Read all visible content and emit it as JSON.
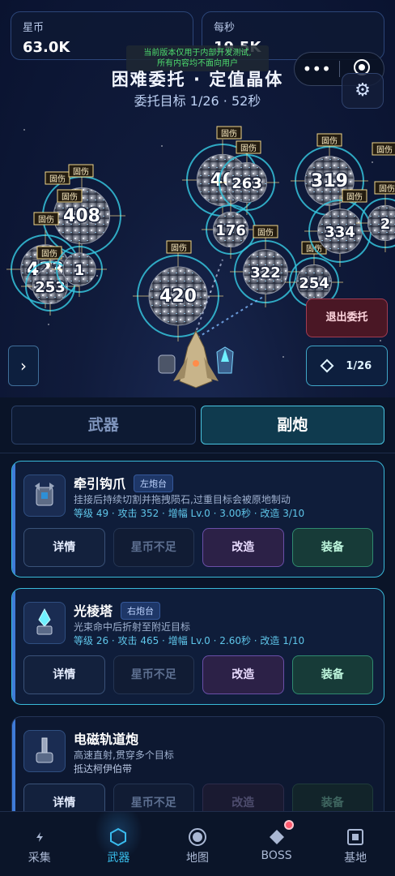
{
  "stats": {
    "stars_label": "星币",
    "stars_value": "63.0K",
    "per_sec_label": "每秒",
    "per_sec_value": "19.5K"
  },
  "dev_notice": {
    "line1": "当前版本仅用于内部开发测试,",
    "line2": "所有内容均不面向用户"
  },
  "mission": {
    "title": "困难委托 · 定值晶体",
    "subtitle": "委托目标 1/26 · 52秒",
    "exit_label": "退出委托",
    "progress_label": "1/26"
  },
  "asteroids": [
    {
      "value": "408",
      "tags": [
        "固伤",
        "固伤"
      ]
    },
    {
      "value": "423",
      "tags": [
        "固伤",
        "固伤"
      ]
    },
    {
      "value": "253",
      "tags": [
        "固伤"
      ]
    },
    {
      "value": "1",
      "tags": []
    },
    {
      "value": "420",
      "tags": [
        "固伤"
      ]
    },
    {
      "value": "40",
      "tags": [
        "固伤"
      ]
    },
    {
      "value": "263",
      "tags": [
        "固伤"
      ]
    },
    {
      "value": "176",
      "tags": []
    },
    {
      "value": "322",
      "tags": [
        "固伤"
      ]
    },
    {
      "value": "254",
      "tags": [
        "固伤"
      ]
    },
    {
      "value": "319",
      "tags": [
        "固伤"
      ]
    },
    {
      "value": "334",
      "tags": [
        "固伤"
      ]
    },
    {
      "value": "2",
      "tags": [
        "固伤",
        "固伤"
      ]
    }
  ],
  "tabs": {
    "weapons": "武器",
    "secondary": "副炮"
  },
  "cards": [
    {
      "name": "牵引钩爪",
      "mount": "左炮台",
      "desc": "挂接后持续切割并拖拽陨石,过重目标会被原地制动",
      "stats": "等级 49 · 攻击 352 · 增幅 Lv.0 · 3.00秒 · 改造 3/10",
      "btn_detail": "详情",
      "btn_cost": "星币不足",
      "btn_mod": "改造",
      "btn_equip": "装备"
    },
    {
      "name": "光棱塔",
      "mount": "右炮台",
      "desc": "光束命中后折射至附近目标",
      "stats": "等级 26 · 攻击 465 · 增幅 Lv.0 · 2.60秒 · 改造 1/10",
      "btn_detail": "详情",
      "btn_cost": "星币不足",
      "btn_mod": "改造",
      "btn_equip": "装备"
    },
    {
      "name": "电磁轨道炮",
      "desc": "高速直射,贯穿多个目标",
      "stats": "抵达柯伊伯带",
      "btn_detail": "详情",
      "btn_cost": "星币不足",
      "btn_mod": "改造",
      "btn_equip": "装备"
    }
  ],
  "nav": [
    {
      "label": "采集",
      "icon": "bolt-icon"
    },
    {
      "label": "武器",
      "icon": "hexagon-icon"
    },
    {
      "label": "地图",
      "icon": "planet-icon"
    },
    {
      "label": "BOSS",
      "icon": "diamond-icon"
    },
    {
      "label": "基地",
      "icon": "base-icon"
    }
  ],
  "colors": {
    "accent": "#39c0ee",
    "danger": "#ff5a6e",
    "ring": "#35c3dc",
    "tag": "#f0d68a"
  }
}
